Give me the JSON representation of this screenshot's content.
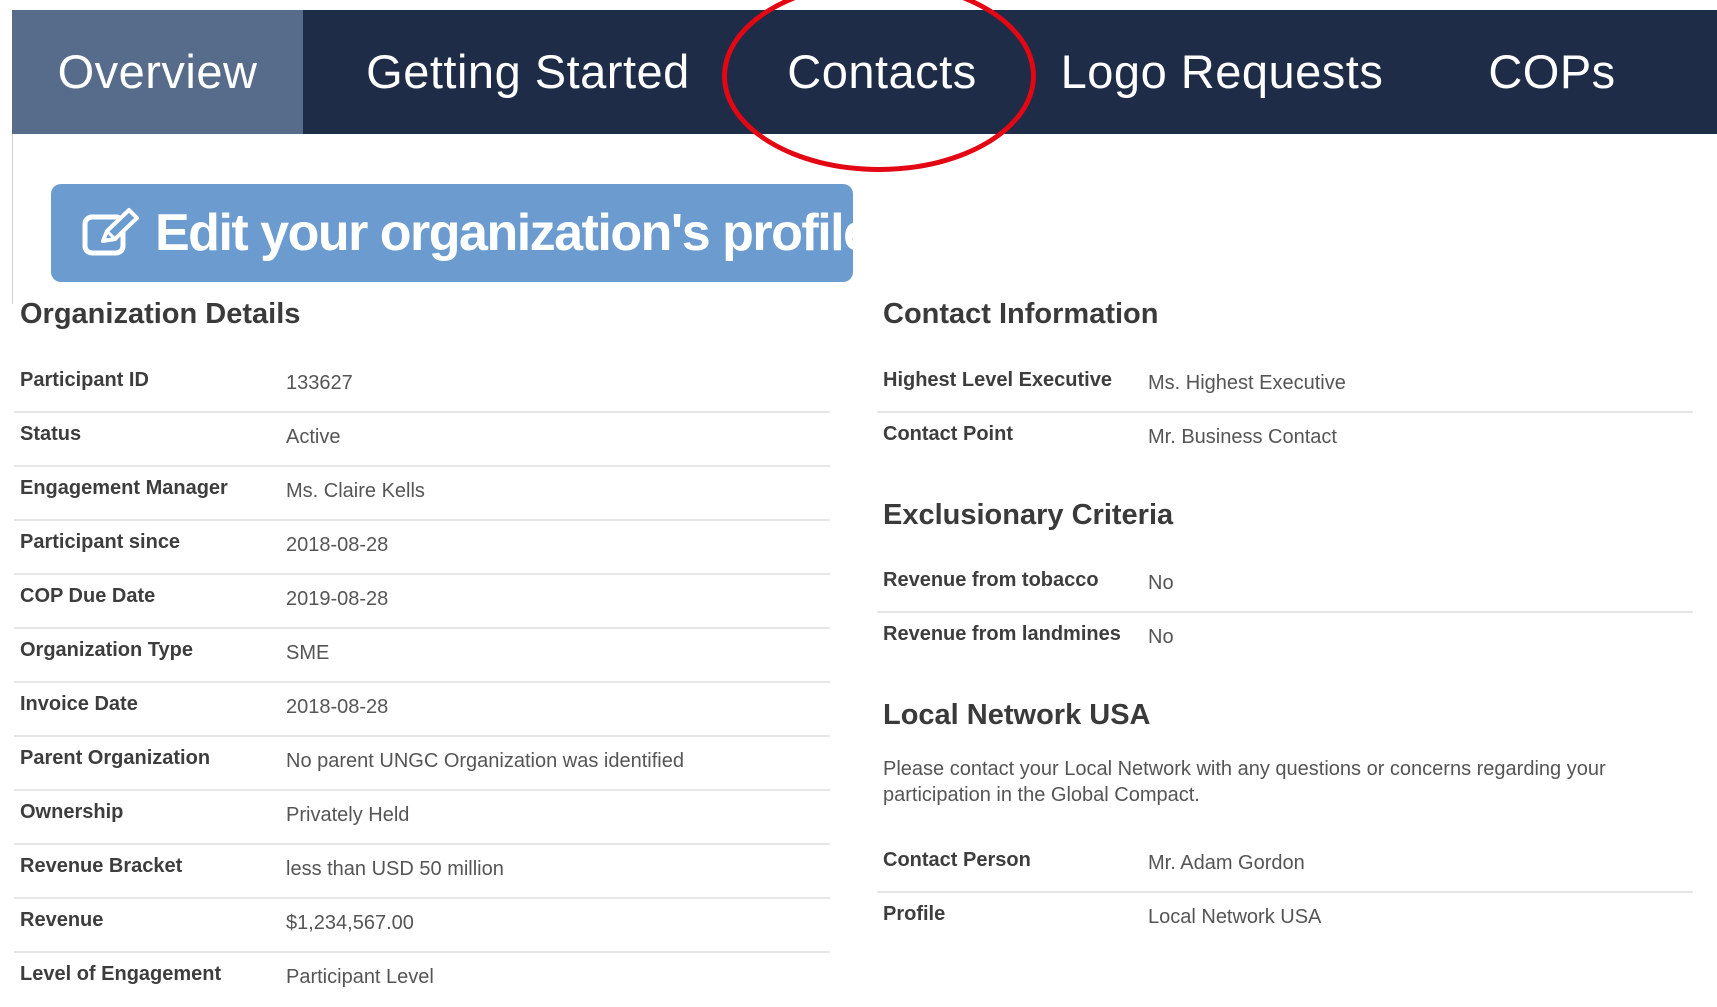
{
  "nav": {
    "tabs": [
      {
        "label": "Overview",
        "active": true
      },
      {
        "label": "Getting Started",
        "active": false
      },
      {
        "label": "Contacts",
        "active": false,
        "highlighted": true
      },
      {
        "label": "Logo Requests",
        "active": false
      },
      {
        "label": "COPs",
        "active": false
      }
    ]
  },
  "edit_button": {
    "label": "Edit your organization's profile",
    "icon": "edit-icon"
  },
  "org_details": {
    "title": "Organization Details",
    "rows": [
      {
        "label": "Participant ID",
        "value": "133627"
      },
      {
        "label": "Status",
        "value": "Active"
      },
      {
        "label": "Engagement Manager",
        "value": "Ms. Claire Kells"
      },
      {
        "label": "Participant since",
        "value": "2018-08-28"
      },
      {
        "label": "COP Due Date",
        "value": "2019-08-28"
      },
      {
        "label": "Organization Type",
        "value": "SME"
      },
      {
        "label": "Invoice Date",
        "value": "2018-08-28"
      },
      {
        "label": "Parent Organization",
        "value": "No parent UNGC Organization was identified"
      },
      {
        "label": "Ownership",
        "value": "Privately Held"
      },
      {
        "label": "Revenue Bracket",
        "value": "less than USD 50 million"
      },
      {
        "label": "Revenue",
        "value": "$1,234,567.00"
      },
      {
        "label": "Level of Engagement",
        "value": "Participant Level"
      }
    ]
  },
  "contact_info": {
    "title": "Contact Information",
    "rows": [
      {
        "label": "Highest Level Executive",
        "value": "Ms. Highest Executive"
      },
      {
        "label": "Contact Point",
        "value": "Mr. Business Contact"
      }
    ]
  },
  "exclusionary": {
    "title": "Exclusionary Criteria",
    "rows": [
      {
        "label": "Revenue from tobacco",
        "value": "No"
      },
      {
        "label": "Revenue from landmines",
        "value": "No"
      }
    ]
  },
  "local_network": {
    "title": "Local Network USA",
    "note": "Please contact your Local Network with any questions or concerns regarding your participation in the Global Compact.",
    "rows": [
      {
        "label": "Contact Person",
        "value": "Mr. Adam Gordon"
      },
      {
        "label": "Profile",
        "value": "Local Network USA"
      }
    ]
  },
  "colors": {
    "nav_bg": "#1f2c47",
    "nav_active": "#566c8a",
    "button_bg": "#6b9bcf",
    "annotation_circle": "#e30613"
  }
}
